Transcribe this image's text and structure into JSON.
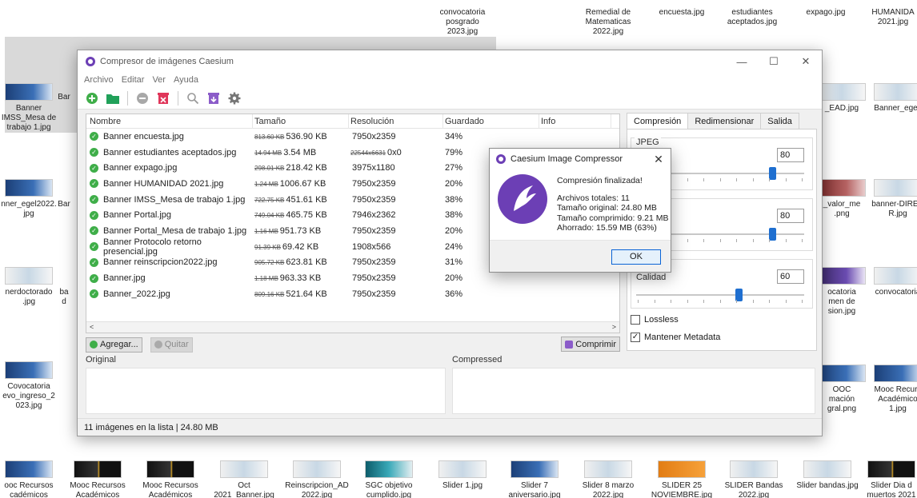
{
  "desktop": {
    "top_files": [
      {
        "name": "convocatoria\nposgrado\n2023.jpg"
      },
      {
        "name": "Remedial de\nMatematicas\n2022.jpg"
      },
      {
        "name": "encuesta.jpg"
      },
      {
        "name": "estudiantes\naceptados.jpg"
      },
      {
        "name": "expago.jpg"
      },
      {
        "name": "HUMANIDA\n2021.jpg"
      }
    ],
    "left_files": [
      {
        "name": "Banner\nIMSS_Mesa de\ntrabajo 1.jpg"
      },
      {
        "name": "Bar"
      },
      {
        "name": "nner_egel2022.\njpg"
      },
      {
        "name": "Bar"
      },
      {
        "name": "nerdoctorado\n.jpg"
      },
      {
        "name": "ba\nd"
      },
      {
        "name": "Covocatoria\nevo_ingreso_2\n023.jpg"
      }
    ],
    "right_files": [
      {
        "name": "_EAD.jpg"
      },
      {
        "name": "Banner_egel."
      },
      {
        "name": "_valor_me\n.png"
      },
      {
        "name": "banner-DIREC\nR.jpg"
      },
      {
        "name": "ocatoria\nmen de\nsion.jpg"
      },
      {
        "name": "convocatoria"
      },
      {
        "name": "OOC\nmación\ngral.png"
      },
      {
        "name": "Mooc Recurs\nAcadémico\n1.jpg"
      }
    ],
    "bottom_files": [
      {
        "name": "ooc Recursos\ncadémicos"
      },
      {
        "name": "Mooc Recursos\nAcadémicos"
      },
      {
        "name": "Mooc Recursos\nAcadémicos"
      },
      {
        "name": "Oct\n2021_Banner.jpg"
      },
      {
        "name": "Reinscripcion_AD\n2022.jpg"
      },
      {
        "name": "SGC objetivo\ncumplido.jpg"
      },
      {
        "name": "Slider 1.jpg"
      },
      {
        "name": "Slider 7\naniversario.jpg"
      },
      {
        "name": "Slider 8 marzo\n2022.jpg"
      },
      {
        "name": "SLIDER 25\nNOVIEMBRE.jpg"
      },
      {
        "name": "SLIDER Bandas\n2022.jpg"
      },
      {
        "name": "Slider bandas.jpg"
      },
      {
        "name": "Slider Dia d\nmuertos 2021"
      }
    ]
  },
  "window": {
    "title": "Compresor de imágenes Caesium",
    "controls": {
      "minimize": "—",
      "maximize": "☐",
      "close": "✕"
    },
    "menu": [
      "Archivo",
      "Editar",
      "Ver",
      "Ayuda"
    ]
  },
  "list": {
    "columns": [
      "Nombre",
      "Tamaño",
      "Resolución",
      "Guardado",
      "Info"
    ],
    "rows": [
      {
        "name": "Banner encuesta.jpg",
        "orig": "813.60 KB",
        "new": "536.90 KB",
        "res_old": "",
        "res": "7950x2359",
        "saved": "34%"
      },
      {
        "name": "Banner estudiantes aceptados.jpg",
        "orig": "14.94 MB",
        "new": "3.54 MB",
        "res_old": "22544x6631",
        "res": "0x0",
        "saved": "79%"
      },
      {
        "name": "Banner expago.jpg",
        "orig": "298.01 KB",
        "new": "218.42 KB",
        "res_old": "",
        "res": "3975x1180",
        "saved": "27%"
      },
      {
        "name": "Banner HUMANIDAD 2021.jpg",
        "orig": "1.24 MB",
        "new": "1006.67 KB",
        "res_old": "",
        "res": "7950x2359",
        "saved": "20%"
      },
      {
        "name": "Banner IMSS_Mesa de trabajo 1.jpg",
        "orig": "722.75 KB",
        "new": "451.61 KB",
        "res_old": "",
        "res": "7950x2359",
        "saved": "38%"
      },
      {
        "name": "Banner Portal.jpg",
        "orig": "749.04 KB",
        "new": "465.75 KB",
        "res_old": "",
        "res": "7946x2362",
        "saved": "38%"
      },
      {
        "name": "Banner Portal_Mesa de trabajo 1.jpg",
        "orig": "1.16 MB",
        "new": "951.73 KB",
        "res_old": "",
        "res": "7950x2359",
        "saved": "20%"
      },
      {
        "name": "Banner Protocolo retorno presencial.jpg",
        "orig": "91.39 KB",
        "new": "69.42 KB",
        "res_old": "",
        "res": "1908x566",
        "saved": "24%"
      },
      {
        "name": "Banner reinscripcion2022.jpg",
        "orig": "905.72 KB",
        "new": "623.81 KB",
        "res_old": "",
        "res": "7950x2359",
        "saved": "31%"
      },
      {
        "name": "Banner.jpg",
        "orig": "1.18 MB",
        "new": "963.33 KB",
        "res_old": "",
        "res": "7950x2359",
        "saved": "20%"
      },
      {
        "name": "Banner_2022.jpg",
        "orig": "809.16 KB",
        "new": "521.64 KB",
        "res_old": "",
        "res": "7950x2359",
        "saved": "36%"
      }
    ],
    "scroll_left": "<",
    "scroll_right": ">"
  },
  "actions": {
    "add": "Agregar...",
    "remove": "Quitar",
    "compress": "Comprimir"
  },
  "settings": {
    "tabs": [
      "Compresión",
      "Redimensionar",
      "Salida"
    ],
    "jpeg_label": "JPEG",
    "jpeg_value": "80",
    "png_value": "80",
    "quality_label": "Calidad",
    "quality_value": "60",
    "lossless_label": "Lossless",
    "keep_metadata_label": "Mantener Metadata",
    "lossless_checked": false,
    "keep_metadata_checked": true
  },
  "preview": {
    "original_label": "Original",
    "compressed_label": "Compressed"
  },
  "status": {
    "text": "11 imágenes en la lista | 24.80 MB"
  },
  "dialog": {
    "title": "Caesium Image Compressor",
    "close": "✕",
    "heading": "Compresión finalizada!",
    "total_files": "Archivos totales: 11",
    "original_size": "Tamaño original: 24.80 MB",
    "compressed_size": "Tamaño comprimido: 9.21 MB",
    "saved": "Ahorrado: 15.59 MB (63%)",
    "ok": "OK"
  },
  "colors": {
    "accent": "#6c3fb5",
    "success": "#3fae49",
    "slider": "#1f6fd0",
    "danger": "#e0365a"
  }
}
